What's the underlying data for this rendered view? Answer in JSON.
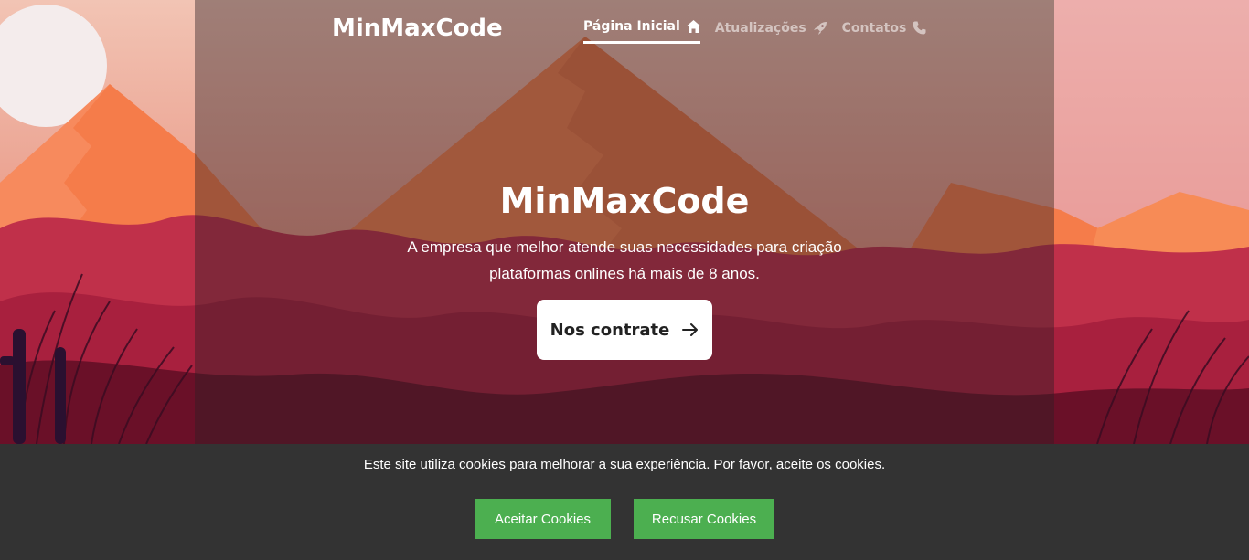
{
  "header": {
    "brand": "MinMaxCode",
    "nav": [
      {
        "label": "Página Inicial",
        "icon": "home-icon",
        "active": true
      },
      {
        "label": "Atualizações",
        "icon": "rocket-icon",
        "active": false
      },
      {
        "label": "Contatos",
        "icon": "phone-icon",
        "active": false
      }
    ]
  },
  "hero": {
    "title": "MinMaxCode",
    "subtitle": "A empresa que melhor atende suas necessidades para criação plataformas onlines há mais de 8 anos.",
    "cta_label": "Nos contrate",
    "cta_icon": "arrow-right-icon"
  },
  "cookies": {
    "message": "Este site utiliza cookies para melhorar a sua experiência. Por favor, aceite os cookies.",
    "accept_label": "Aceitar Cookies",
    "reject_label": "Recusar Cookies"
  },
  "colors": {
    "sky_top": "#f0b8a8",
    "mountain": "#f57c4a",
    "foliage": "#c0304a",
    "foreground": "#6a1028",
    "cookie_bar": "#333333",
    "button_green": "#4caf50"
  }
}
